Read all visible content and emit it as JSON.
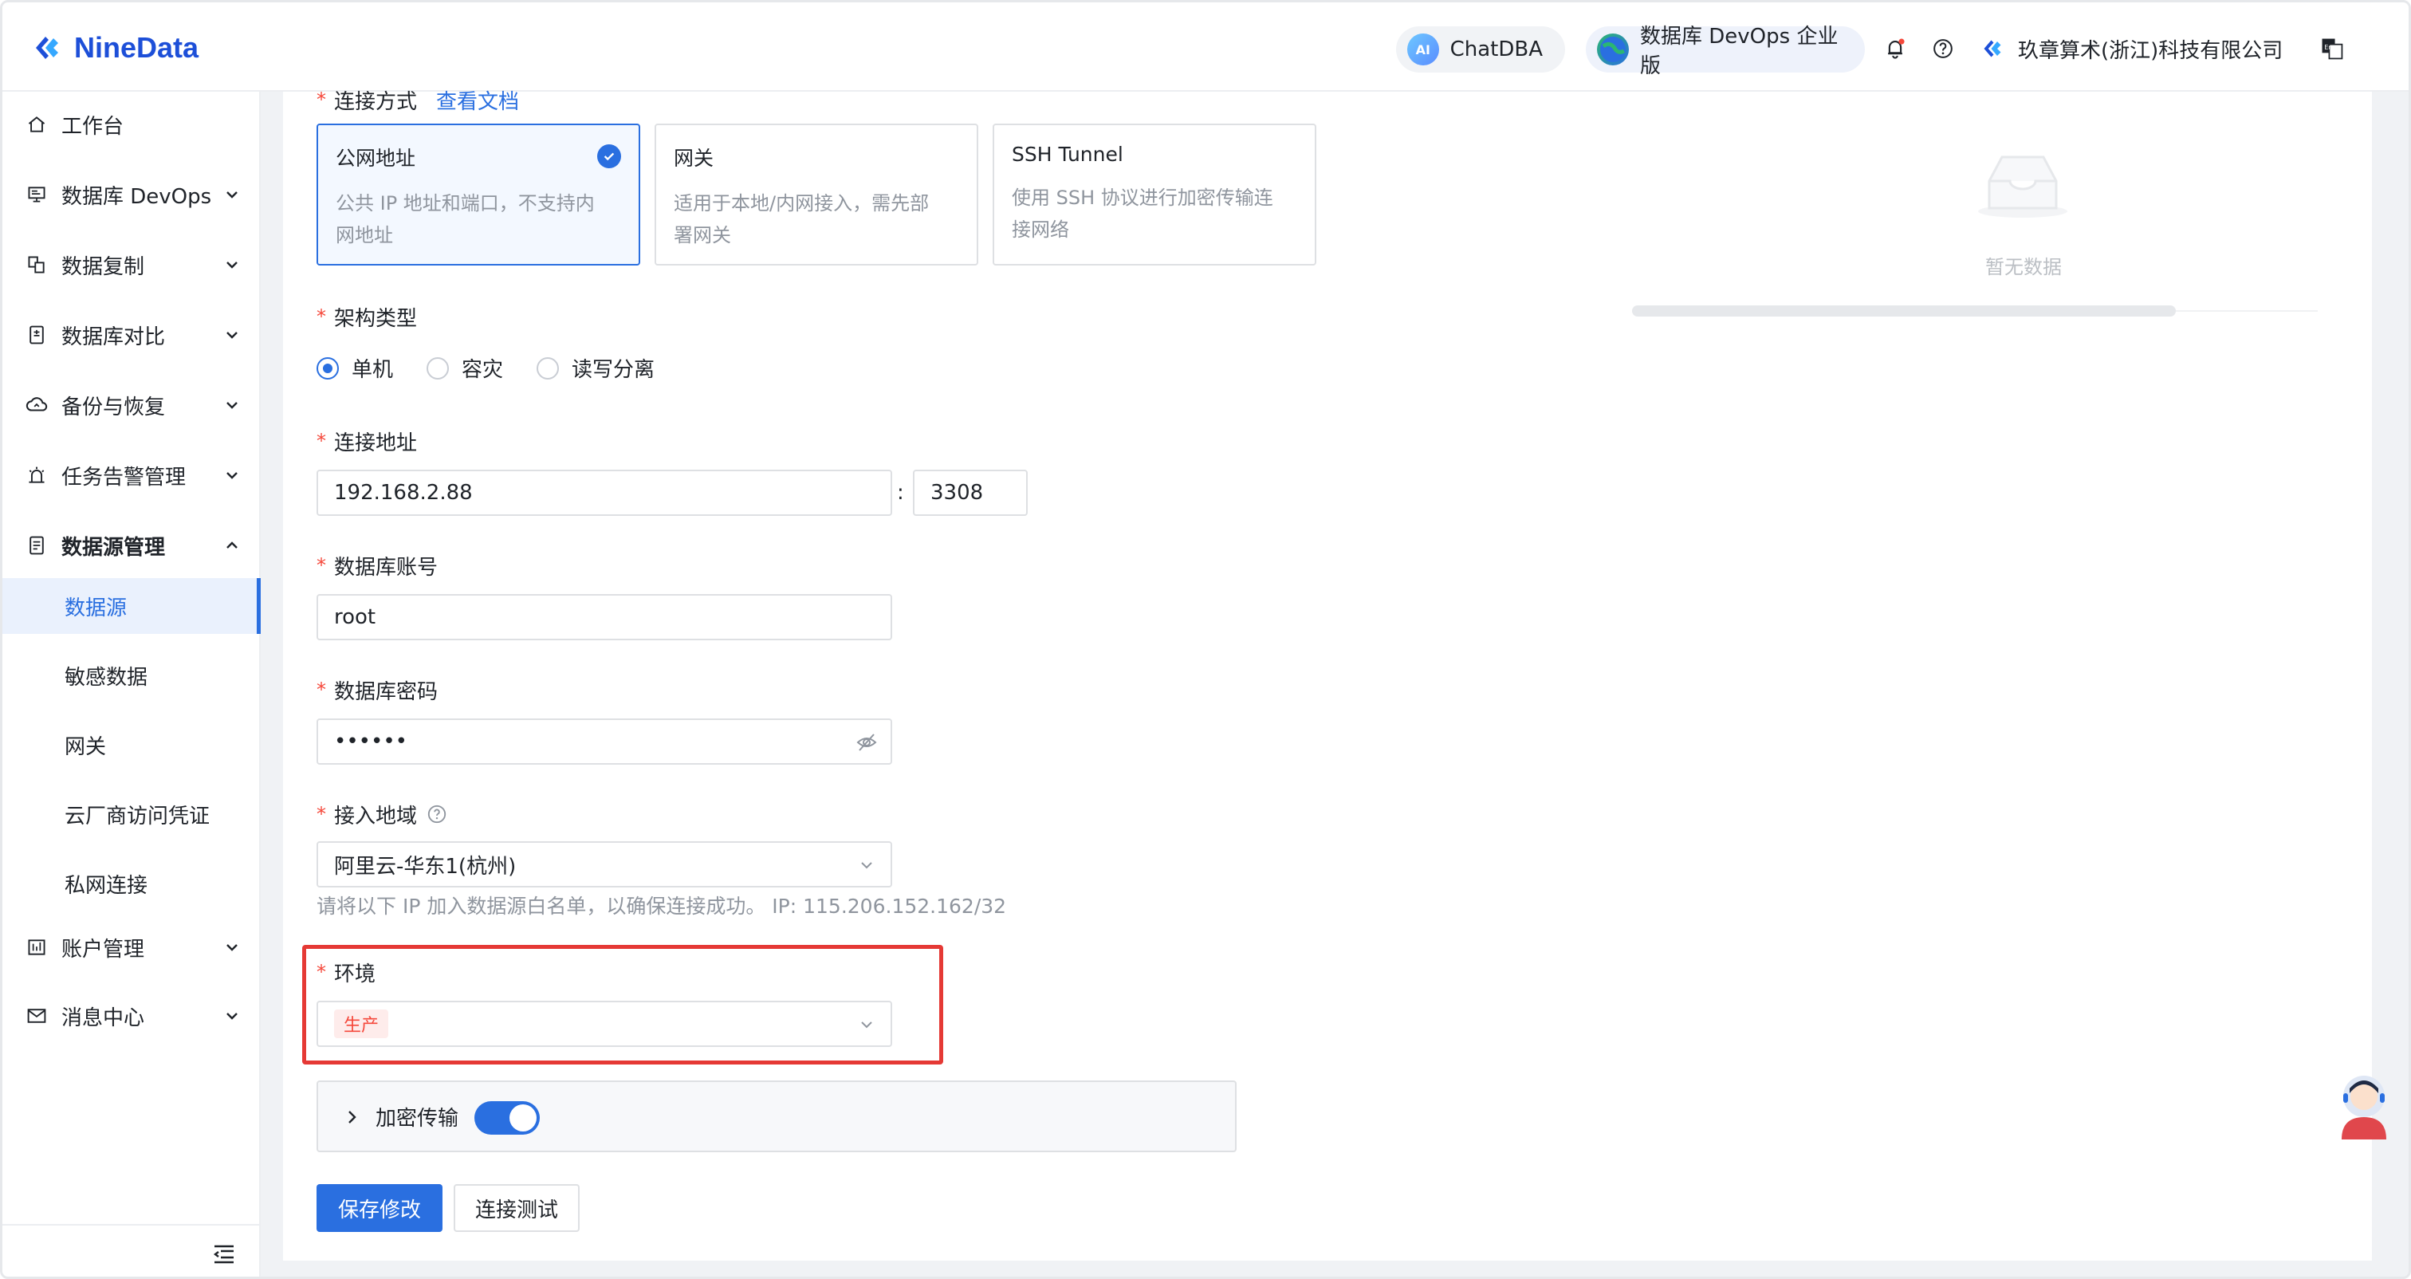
{
  "brand": {
    "name": "NineData"
  },
  "topbar": {
    "chatdba": {
      "icon": "AI",
      "label": "ChatDBA"
    },
    "edition": {
      "label": "数据库 DevOps 企业版"
    },
    "company": "玖章算术(浙江)科技有限公司",
    "icons": [
      "bell-icon",
      "help-icon",
      "language-icon"
    ]
  },
  "sidebar": {
    "items": [
      {
        "label": "工作台",
        "icon": "home-icon"
      },
      {
        "label": "数据库 DevOps",
        "icon": "monitor-icon"
      },
      {
        "label": "数据复制",
        "icon": "copy-icon"
      },
      {
        "label": "数据库对比",
        "icon": "compare-icon"
      },
      {
        "label": "备份与恢复",
        "icon": "cloud-icon"
      },
      {
        "label": "任务告警管理",
        "icon": "alarm-icon"
      },
      {
        "label": "数据源管理",
        "icon": "datasource-icon"
      }
    ],
    "sub_items": [
      {
        "label": "数据源"
      },
      {
        "label": "敏感数据"
      },
      {
        "label": "网关"
      },
      {
        "label": "云厂商访问凭证"
      },
      {
        "label": "私网连接"
      }
    ],
    "bottom_items": [
      {
        "label": "账户管理",
        "icon": "account-icon"
      },
      {
        "label": "消息中心",
        "icon": "mail-icon"
      }
    ]
  },
  "form": {
    "conn_method": {
      "label": "连接方式",
      "doc_link": "查看文档",
      "options": [
        {
          "title": "公网地址",
          "desc_line1": "公共 IP 地址和端口，不支持内",
          "desc_line2": "网地址"
        },
        {
          "title": "网关",
          "desc_line1": "适用于本地/内网接入，需先部",
          "desc_line2": "署网关"
        },
        {
          "title": "SSH Tunnel",
          "desc_line1": "使用 SSH 协议进行加密传输连",
          "desc_line2": "接网络"
        }
      ]
    },
    "arch": {
      "label": "架构类型",
      "options": [
        "单机",
        "容灾",
        "读写分离"
      ]
    },
    "address": {
      "label": "连接地址",
      "host": "192.168.2.88",
      "separator": ":",
      "port": "3308"
    },
    "account": {
      "label": "数据库账号",
      "value": "root"
    },
    "password": {
      "label": "数据库密码",
      "value": "••••••"
    },
    "region": {
      "label": "接入地域",
      "value": "阿里云-华东1(杭州)",
      "helper": "请将以下 IP 加入数据源白名单，以确保连接成功。 IP: 115.206.152.162/32"
    },
    "env": {
      "label": "环境",
      "tag": "生产"
    },
    "encryption": {
      "label": "加密传输"
    },
    "buttons": {
      "save": "保存修改",
      "test": "连接测试"
    }
  },
  "empty": {
    "text": "暂无数据"
  },
  "colors": {
    "primary": "#2a6fe0",
    "danger": "#f5483b",
    "highlight": "#e53935"
  }
}
